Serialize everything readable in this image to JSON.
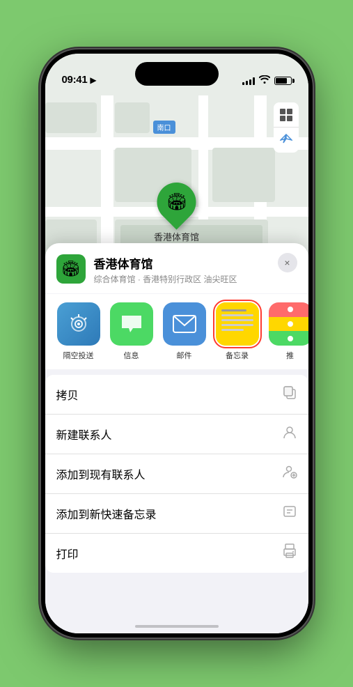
{
  "status_bar": {
    "time": "09:41",
    "location_arrow": "▶"
  },
  "map": {
    "label_text": "南口",
    "pin_label": "香港体育馆"
  },
  "map_controls": {
    "map_btn": "⊞",
    "location_btn": "➤"
  },
  "sheet": {
    "venue_name": "香港体育馆",
    "venue_subtitle": "综合体育馆 · 香港特别行政区 油尖旺区",
    "close_label": "×"
  },
  "actions": [
    {
      "id": "airdrop",
      "label": "隔空投送",
      "emoji": "📡"
    },
    {
      "id": "messages",
      "label": "信息",
      "emoji": "💬"
    },
    {
      "id": "mail",
      "label": "邮件",
      "emoji": "✉️"
    },
    {
      "id": "notes",
      "label": "备忘录",
      "emoji": "📋"
    },
    {
      "id": "more",
      "label": "推",
      "emoji": "•••"
    }
  ],
  "menu_items": [
    {
      "id": "copy",
      "label": "拷贝",
      "icon": "📋"
    },
    {
      "id": "new-contact",
      "label": "新建联系人",
      "icon": "👤"
    },
    {
      "id": "add-contact",
      "label": "添加到现有联系人",
      "icon": "👤"
    },
    {
      "id": "quick-note",
      "label": "添加到新快速备忘录",
      "icon": "⬛"
    },
    {
      "id": "print",
      "label": "打印",
      "icon": "🖨"
    }
  ]
}
